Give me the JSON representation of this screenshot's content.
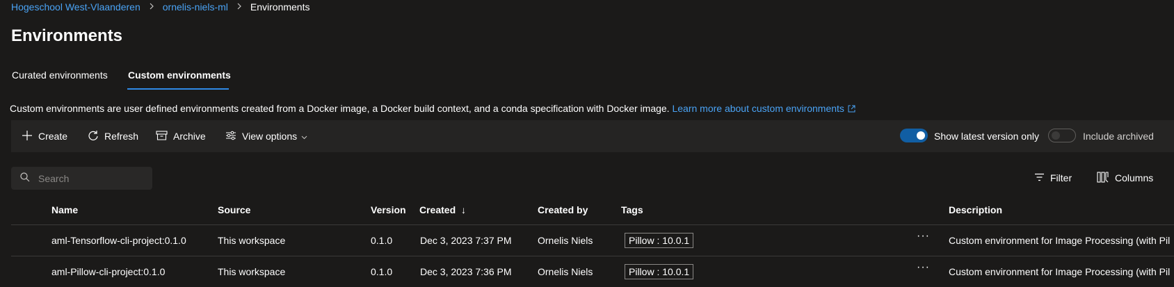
{
  "breadcrumb": {
    "items": [
      "Hogeschool West-Vlaanderen",
      "ornelis-niels-ml"
    ],
    "current": "Environments"
  },
  "page": {
    "title": "Environments"
  },
  "tabs": [
    {
      "label": "Curated environments",
      "active": false
    },
    {
      "label": "Custom environments",
      "active": true
    }
  ],
  "description": {
    "text": "Custom environments are user defined environments created from a Docker image, a Docker build context, and a conda specification with Docker image.",
    "link": "Learn more about custom environments"
  },
  "toolbar": {
    "create": "Create",
    "refresh": "Refresh",
    "archive": "Archive",
    "view_options": "View options",
    "show_latest_label": "Show latest version only",
    "show_latest_on": true,
    "include_archived_label": "Include archived",
    "include_archived_on": false
  },
  "search": {
    "placeholder": "Search"
  },
  "actions": {
    "filter": "Filter",
    "columns": "Columns"
  },
  "table": {
    "headers": {
      "name": "Name",
      "source": "Source",
      "version": "Version",
      "created": "Created",
      "created_by": "Created by",
      "tags": "Tags",
      "description": "Description"
    },
    "sort_indicator": "↓",
    "more_glyph": "···",
    "rows": [
      {
        "name": "aml-Tensorflow-cli-project:0.1.0",
        "source": "This workspace",
        "version": "0.1.0",
        "created": "Dec 3, 2023 7:37 PM",
        "created_by": "Ornelis Niels",
        "tag": "Pillow : 10.0.1",
        "description": "Custom environment for Image Processing (with Pil"
      },
      {
        "name": "aml-Pillow-cli-project:0.1.0",
        "source": "This workspace",
        "version": "0.1.0",
        "created": "Dec 3, 2023 7:36 PM",
        "created_by": "Ornelis Niels",
        "tag": "Pillow : 10.0.1",
        "description": "Custom environment for Image Processing (with Pil"
      }
    ]
  },
  "colors": {
    "background": "#1b1a19",
    "toolbar": "#252423",
    "link": "#4aa3f5",
    "accent": "#2f8ae6",
    "toggle_on": "#115ea3"
  }
}
